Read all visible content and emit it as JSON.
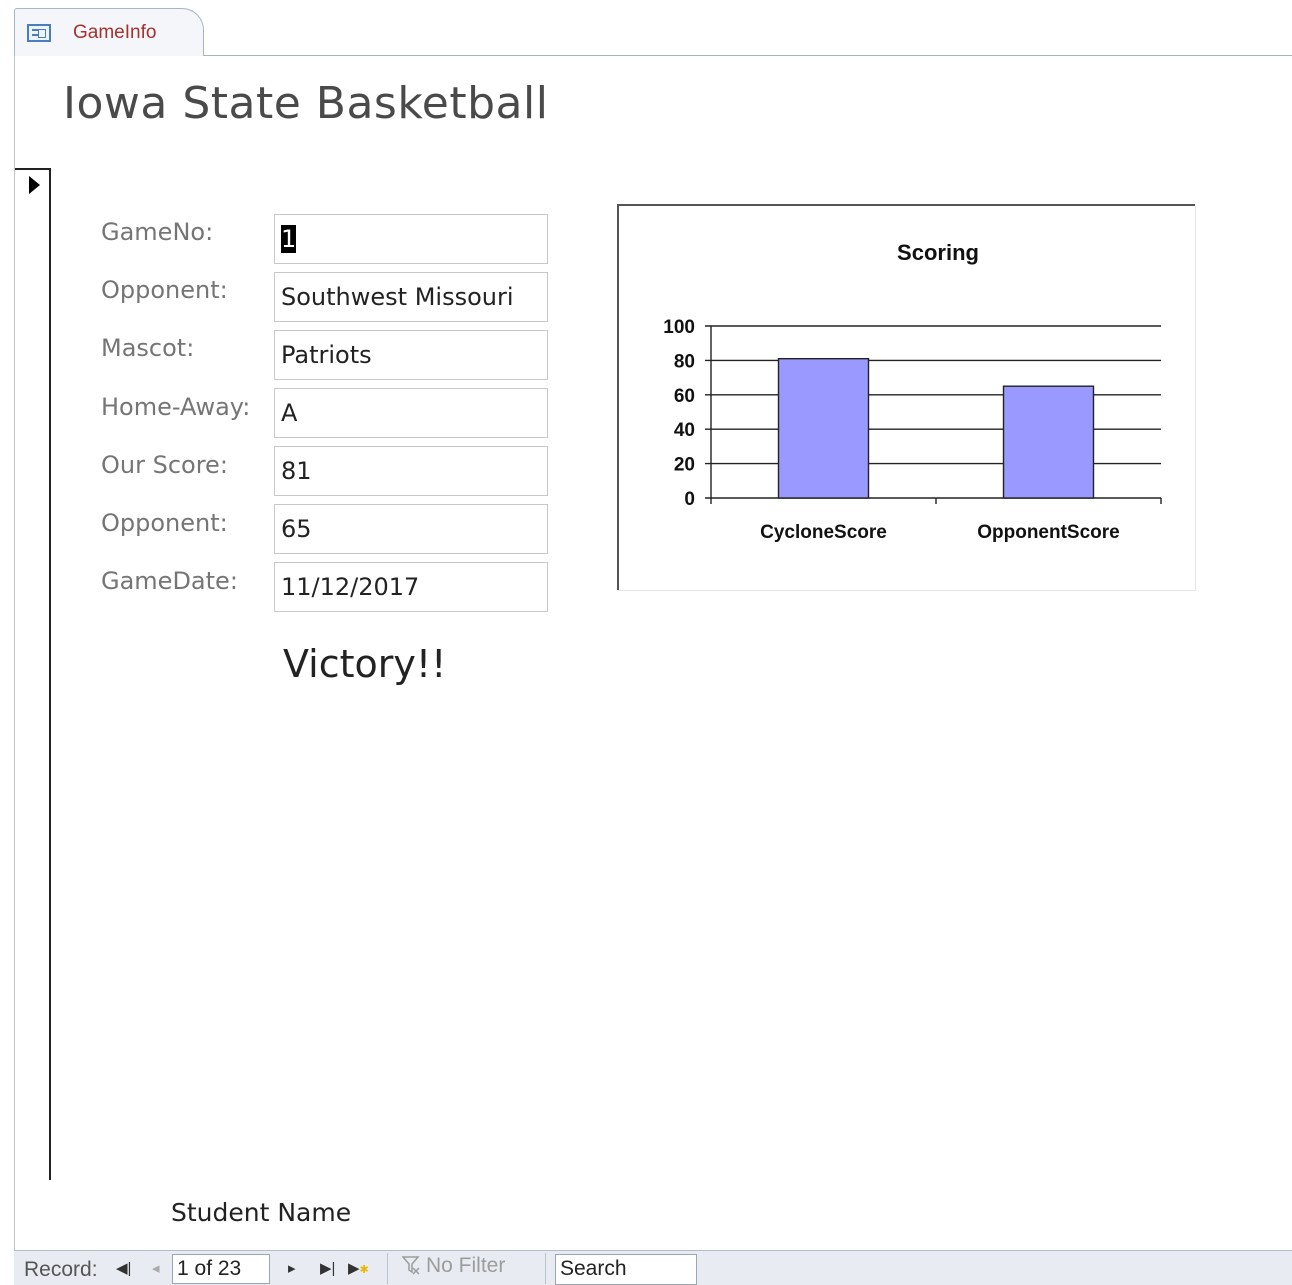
{
  "tab": {
    "label": "GameInfo",
    "icon": "form-icon"
  },
  "form": {
    "title": "Iowa State Basketball",
    "fields": [
      {
        "label": "GameNo:",
        "value": "1"
      },
      {
        "label": "Opponent:",
        "value": "Southwest Missouri"
      },
      {
        "label": "Mascot:",
        "value": "Patriots"
      },
      {
        "label": "Home-Away:",
        "value": "A"
      },
      {
        "label": "Our Score:",
        "value": "81"
      },
      {
        "label": "Opponent:",
        "value": "65"
      },
      {
        "label": "GameDate:",
        "value": "11/12/2017"
      }
    ],
    "result": "Victory!!",
    "footer": "Student Name"
  },
  "chart_data": {
    "type": "bar",
    "title": "Scoring",
    "categories": [
      "CycloneScore",
      "OpponentScore"
    ],
    "values": [
      81,
      65
    ],
    "ylim": [
      0,
      100
    ],
    "yticks": [
      "0",
      "20",
      "40",
      "60",
      "80",
      "100"
    ],
    "bar_color": "#9999ff",
    "grid": true,
    "legend": "none"
  },
  "navbar": {
    "record_label": "Record:",
    "position": "1 of 23",
    "filter_label": "No Filter",
    "search_label": "Search"
  }
}
